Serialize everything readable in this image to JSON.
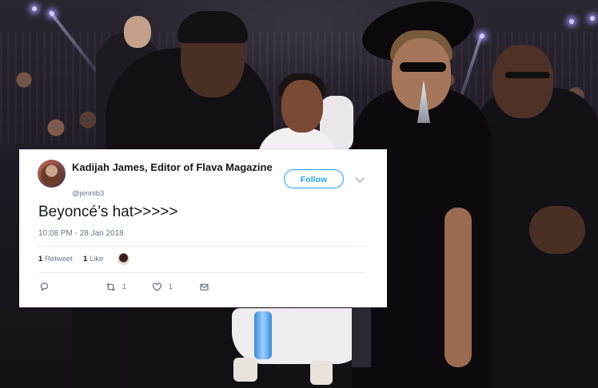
{
  "tweet": {
    "display_name": "Kadijah James, Editor of Flava Magazine",
    "handle": "@jennib3",
    "follow_label": "Follow",
    "text": "Beyoncé’s hat>>>>>",
    "timestamp": "10:08 PM - 28 Jan 2018",
    "retweets_count": "1",
    "retweets_label": "Retweet",
    "likes_count": "1",
    "likes_label": "Like",
    "actions": {
      "reply_icon": "reply-icon",
      "retweet_icon": "retweet-icon",
      "retweet_count": "1",
      "like_icon": "heart-icon",
      "like_count": "1",
      "dm_icon": "envelope-icon"
    }
  },
  "colors": {
    "accent": "#1da1f2",
    "text_primary": "#14171a",
    "text_secondary": "#657786",
    "divider": "#e6ecf0"
  }
}
